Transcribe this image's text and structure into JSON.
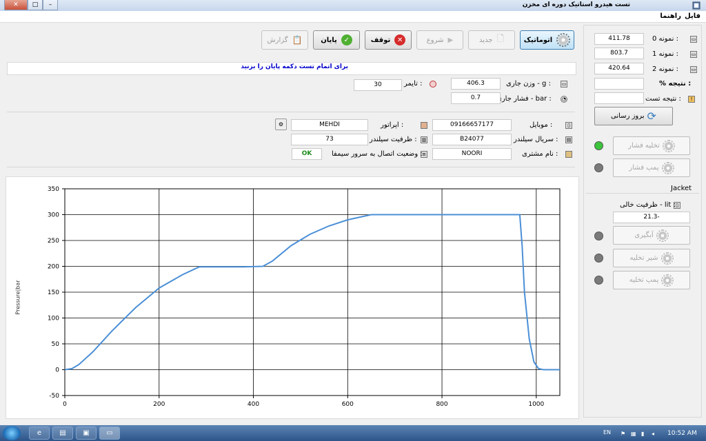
{
  "window": {
    "title": "تست هیدرو استاتیک دوره ای مخزن"
  },
  "menu": {
    "file": "فایل",
    "help": "راهنما"
  },
  "toolbar": {
    "automatic": "اتوماتیک",
    "new": "جدید",
    "start": "شروع",
    "stop": "توقف",
    "finish": "پایان",
    "report": "گزارش"
  },
  "message": "برای اتمام تست دکمه پایان را بزنید",
  "readings": {
    "weight_label": "وزن جاری - g :",
    "weight_value": "406.3",
    "pressure_label": "فشار جاری - bar :",
    "pressure_value": "0.7",
    "timer_label": "تایمر :",
    "timer_value": "30"
  },
  "info": {
    "mobile_label": "موبایل :",
    "mobile_value": "09166657177",
    "operator_label": "اپراتور :",
    "operator_value": "MEHDI",
    "serial_label": "سریال سیلندر :",
    "serial_value": "B24077",
    "capacity_label": "ظرفیت سیلندر :",
    "capacity_value": "73",
    "customer_label": "نام مشتری :",
    "customer_value": "NOORI",
    "server_label": "وضعیت اتصال به سرور سیمفا :",
    "server_value": "OK"
  },
  "samples": {
    "s0_label": "نمونه 0 :",
    "s0_value": "411.78",
    "s1_label": "نمونه 1 :",
    "s1_value": "803.7",
    "s2_label": "نمونه 2 :",
    "s2_value": "420.64",
    "result_pct_label": "% نتیجه :",
    "result_pct_value": "",
    "test_result_label": "نتیجه تست :",
    "test_result_value": ""
  },
  "controls": {
    "update_button": "بروز رسانی",
    "pressure_release": "تخلیه فشار",
    "pressure_pump": "پمپ فشار",
    "jacket_title": "Jacket",
    "empty_capacity_label": "ظرفیت خالی - lit :",
    "empty_capacity_value": "21.3-",
    "fill_water": "آبگیری",
    "drain_valve": "شیر تخلیه",
    "drain_pump": "پمپ تخلیه"
  },
  "leds": {
    "pressure_release": "#3cc43c",
    "pressure_pump": "#7a7a7a",
    "fill": "#7a7a7a",
    "drain_valve": "#7a7a7a",
    "drain_pump": "#7a7a7a"
  },
  "taskbar": {
    "lang": "EN",
    "clock": "10:52 AM"
  },
  "chart_data": {
    "type": "line",
    "ylabel": "Pressure|bar",
    "xlim": [
      0,
      1050
    ],
    "ylim": [
      -50,
      350
    ],
    "xticks": [
      0,
      200,
      400,
      600,
      800,
      1000
    ],
    "yticks": [
      -50,
      0,
      50,
      100,
      150,
      200,
      250,
      300,
      350
    ],
    "grid": true,
    "line_color": "#4a8fd6",
    "series": [
      {
        "x": [
          0,
          15,
          30,
          60,
          100,
          150,
          200,
          250,
          285,
          320,
          380,
          420,
          440,
          480,
          520,
          560,
          600,
          650,
          700,
          800,
          900,
          965,
          970,
          975,
          985,
          995,
          1005,
          1015,
          1030,
          1050
        ],
        "y": [
          0,
          2,
          10,
          35,
          75,
          120,
          158,
          184,
          199,
          199,
          199,
          200,
          210,
          240,
          262,
          278,
          290,
          300,
          300,
          300,
          300,
          300,
          240,
          150,
          60,
          15,
          2,
          0,
          0,
          0
        ]
      }
    ]
  }
}
